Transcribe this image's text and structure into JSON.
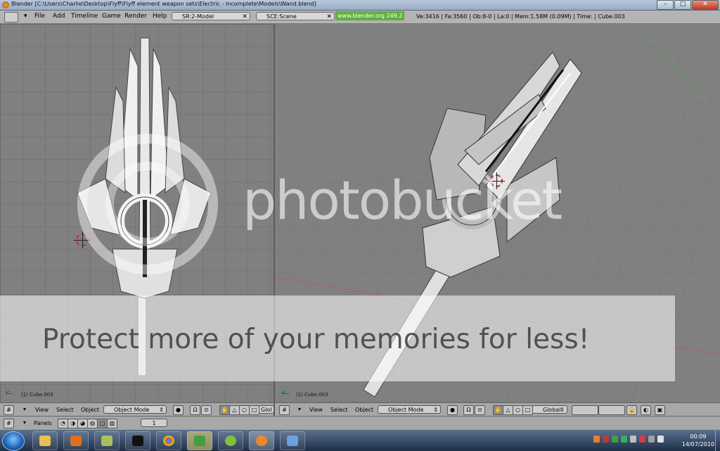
{
  "window": {
    "title": "Blender [C:\\Users\\Charlie\\Desktop\\Flyff\\Flyff element weapon sets\\Electric - Incomplete\\Models\\Wand.blend]",
    "minimize": "–",
    "maximize": "□",
    "close": "✕"
  },
  "menubar": {
    "items": [
      "File",
      "Add",
      "Timeline",
      "Game",
      "Render",
      "Help"
    ],
    "screen_field": "SR:2-Model",
    "scene_field": "SCE:Scene",
    "url": "www.blender.org 249.2",
    "stats": "Ve:3416 | Fa:3560 | Ob:8-0 | La:0 | Mem:1.58M (0.09M) | Time: | Cube.003"
  },
  "viewports": {
    "left": {
      "label": "(1) Cube.003"
    },
    "right": {
      "label": "(1) Cube.003"
    }
  },
  "view_header_left": {
    "view": "View",
    "select": "Select",
    "object": "Object",
    "mode": "Object Mode",
    "orientation": "Glol"
  },
  "view_header_right": {
    "view": "View",
    "select": "Select",
    "object": "Object",
    "mode": "Object Mode",
    "orientation": "Global"
  },
  "buttons_bar": {
    "panels": "Panels",
    "frame": "1"
  },
  "watermark": {
    "logo": "photobucket",
    "tagline": "Protect more of your memories for less!"
  },
  "taskbar": {
    "time": "00:09",
    "date": "14/07/2010"
  },
  "colors": {
    "viewport": "#808080",
    "header": "#a8a8a8",
    "accent_green": "#60b040"
  }
}
